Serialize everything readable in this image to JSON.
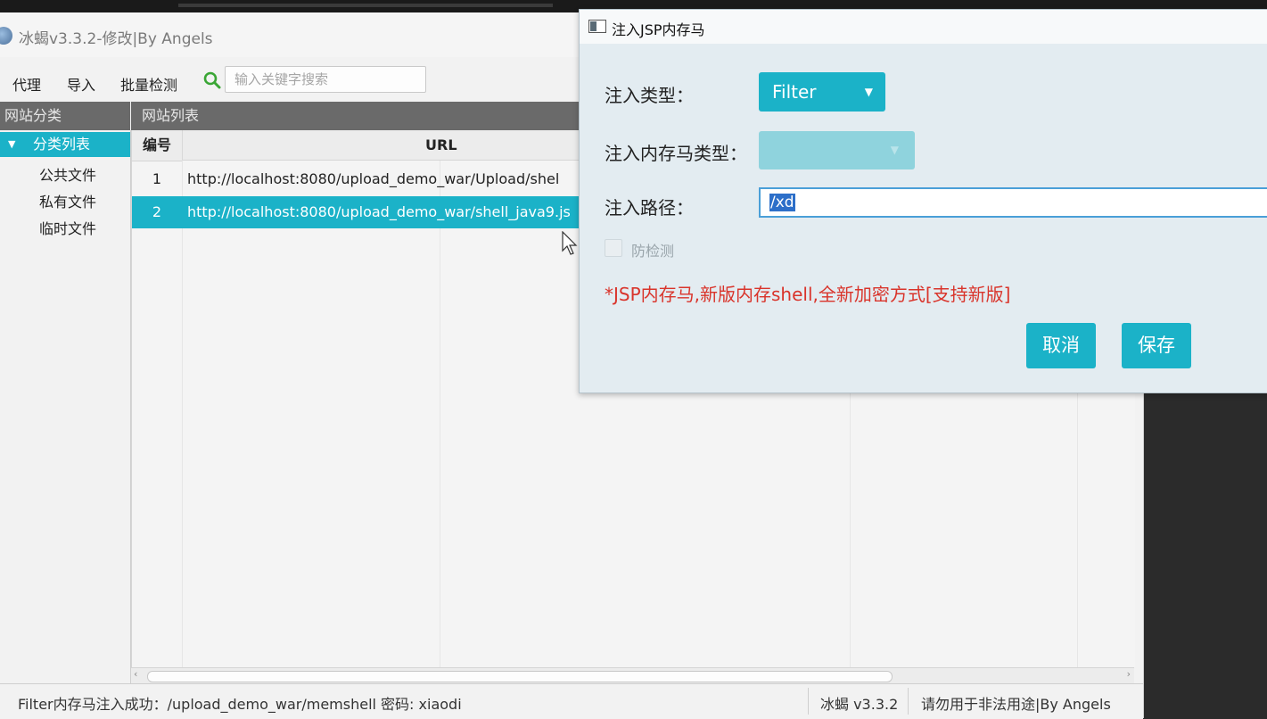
{
  "app": {
    "title": "冰蝎v3.3.2-修改|By Angels"
  },
  "toolbar": {
    "proxy_label": "代理",
    "import_label": "导入",
    "batch_label": "批量检测",
    "search_placeholder": "输入关键字搜索"
  },
  "sidebar": {
    "header": "网站分类",
    "root_label": "分类列表",
    "items": [
      {
        "label": "公共文件"
      },
      {
        "label": "私有文件"
      },
      {
        "label": "临时文件"
      }
    ]
  },
  "list": {
    "header": "网站列表",
    "columns": [
      "编号",
      "URL"
    ],
    "rows": [
      {
        "num": "1",
        "url": "http://localhost:8080/upload_demo_war/Upload/shel"
      },
      {
        "num": "2",
        "url": "http://localhost:8080/upload_demo_war/shell_java9.js"
      }
    ]
  },
  "status": {
    "message": "Filter内存马注入成功：/upload_demo_war/memshell 密码: xiaodi",
    "version": "冰蝎 v3.3.2",
    "warning": "请勿用于非法用途|By Angels"
  },
  "dialog": {
    "title": "注入JSP内存马",
    "type_label": "注入类型：",
    "type_value": "Filter",
    "memtype_label": "注入内存马类型：",
    "path_label": "注入路径：",
    "path_value": "/xd",
    "anti_detect_label": "防检测",
    "note": "*JSP内存马,新版内存shell,全新加密方式[支持新版]",
    "cancel_label": "取消",
    "save_label": "保存"
  },
  "colors": {
    "accent": "#1bb2c8",
    "header_bg": "#6a6a6a",
    "note_red": "#d9342b"
  }
}
